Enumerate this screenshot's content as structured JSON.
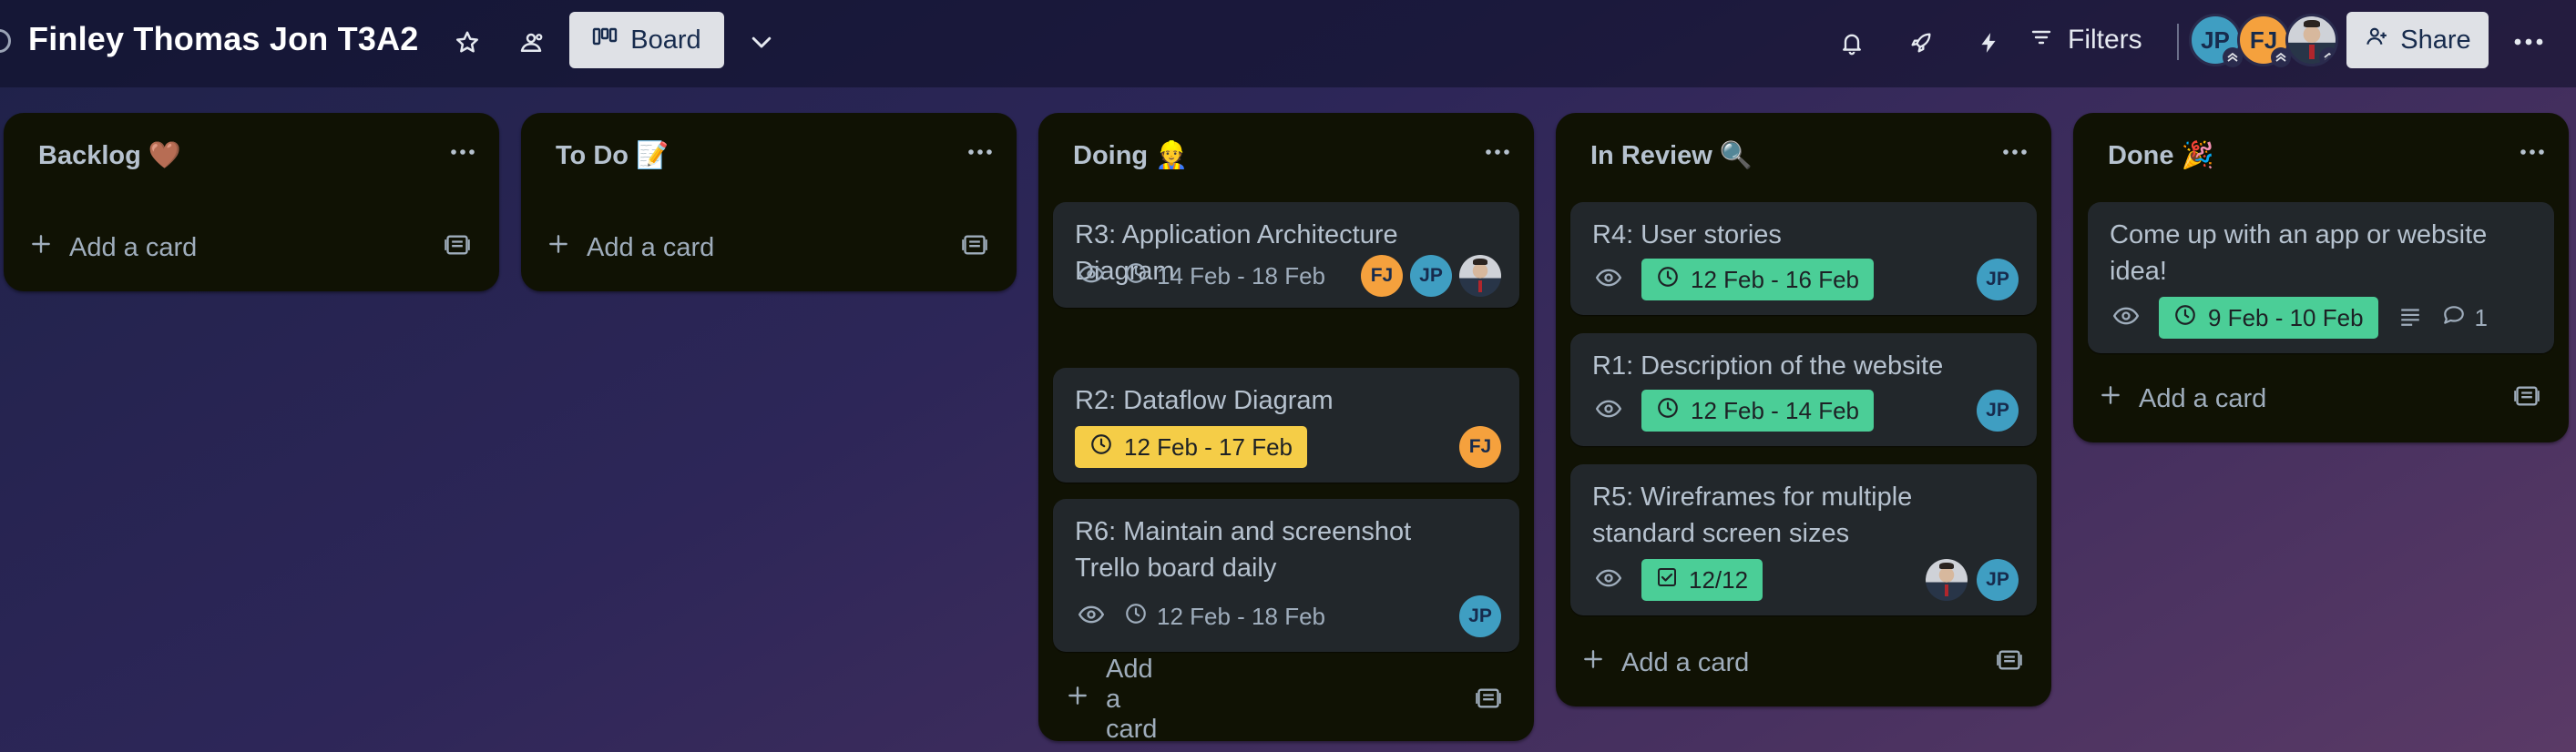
{
  "header": {
    "board_title": "Finley Thomas Jon T3A2",
    "view_button_label": "Board",
    "filters_label": "Filters",
    "share_label": "Share",
    "members": [
      {
        "initials": "JP",
        "color": "#3f9ec2"
      },
      {
        "initials": "FJ",
        "color": "#f5a13d"
      },
      {
        "initials": "",
        "kind": "photo"
      }
    ]
  },
  "lists": {
    "backlog": {
      "title": "Backlog 🤎",
      "add_label": "Add a card"
    },
    "todo": {
      "title": "To Do 📝",
      "add_label": "Add a card"
    },
    "doing": {
      "title": "Doing 👷",
      "add_label": "Add a card",
      "cards": [
        {
          "title": "R3: Application Architecture Diagram",
          "date": "14 Feb - 18 Feb",
          "members": [
            "FJ",
            "JP",
            "photo"
          ]
        },
        {
          "title": "R2: Dataflow Diagram",
          "date": "12 Feb - 17 Feb",
          "members": [
            "FJ"
          ]
        },
        {
          "title": "R6: Maintain and screenshot Trello board daily",
          "date": "12 Feb - 18 Feb",
          "members": [
            "JP"
          ]
        }
      ]
    },
    "review": {
      "title": "In Review 🔍",
      "add_label": "Add a card",
      "cards": [
        {
          "title": "R4: User stories",
          "date": "12 Feb - 16 Feb",
          "members": [
            "JP"
          ]
        },
        {
          "title": "R1: Description of the website",
          "date": "12 Feb - 14 Feb",
          "members": [
            "JP"
          ]
        },
        {
          "title": "R5: Wireframes for multiple standard screen sizes",
          "checklist": "12/12",
          "members": [
            "photo",
            "JP"
          ]
        }
      ]
    },
    "done": {
      "title": "Done 🎉",
      "add_label": "Add a card",
      "cards": [
        {
          "title": "Come up with an app or website idea!",
          "date": "9 Feb - 10 Feb",
          "comments": "1"
        }
      ]
    }
  },
  "colors": {
    "list_bg": "#101204",
    "card_bg": "#22272b",
    "date_green": "#4bce97",
    "date_yellow": "#f5cd47",
    "member_jp": "#3f9ec2",
    "member_fj": "#f5a13d"
  },
  "icons": [
    "star-icon",
    "workspace-visibility-icon",
    "board-view-icon",
    "chevron-down-icon",
    "bell-icon",
    "rocket-icon",
    "lightning-icon",
    "filter-icon",
    "share-user-icon",
    "more-icon",
    "eye-icon",
    "clock-icon",
    "checklist-icon",
    "description-icon",
    "comment-icon",
    "plus-icon",
    "card-template-icon"
  ]
}
